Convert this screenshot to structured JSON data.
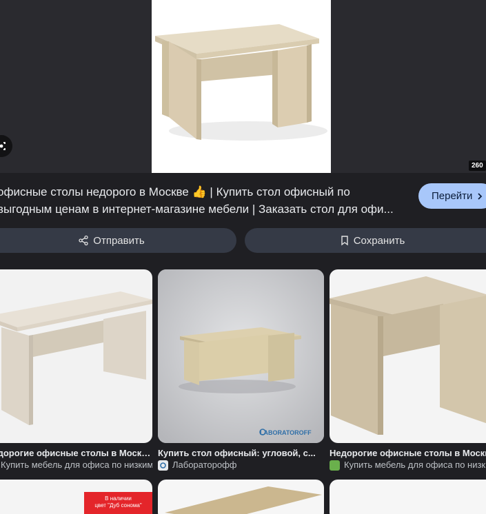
{
  "hero": {
    "size_badge": "260",
    "title_line1": "офисные столы недорого в Москве 👍 | Купить стол офисный по",
    "title_line2": "выгодным ценам в интернет-магазине мебели | Заказать стол для офи...",
    "go_label": "Перейти",
    "share_label": "Отправить",
    "save_label": "Сохранить"
  },
  "results": [
    {
      "title": "Недорогие офисные столы в Москве 🍀 ...",
      "source": "Купить мебель для офиса по низким ...",
      "favicon_color": "#6ab04c"
    },
    {
      "title": "Купить стол офисный: угловой, с...",
      "source": "Лабораторофф",
      "watermark": "LABORATOROFF",
      "favicon_color": "#e8eaed"
    },
    {
      "title": "Недорогие офисные столы в Москве 🍀 ...",
      "source": "Купить мебель для офиса по низким ...",
      "favicon_color": "#6ab04c"
    }
  ],
  "bottom_badge": {
    "line1": "В наличии",
    "line2": "цвет \"Дуб сонома\""
  },
  "colors": {
    "background": "#1f1f23",
    "accent_button": "#a8c7fa",
    "action_button": "#353a46"
  }
}
